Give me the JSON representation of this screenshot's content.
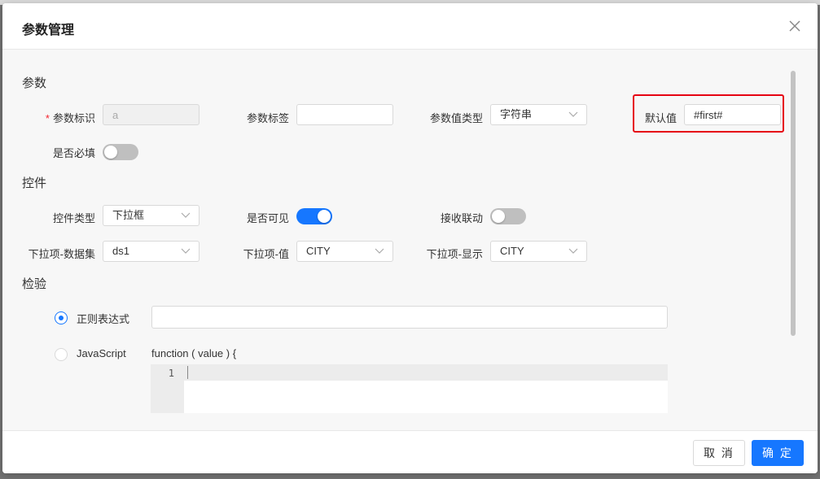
{
  "dialog": {
    "title": "参数管理"
  },
  "sections": {
    "params": "参数",
    "controls": "控件",
    "validation": "检验"
  },
  "params": {
    "id_label": "参数标识",
    "required_mark": "*",
    "id_value": "a",
    "tag_label": "参数标签",
    "tag_value": "",
    "value_type_label": "参数值类型",
    "value_type_selected": "字符串",
    "default_label": "默认值",
    "default_value": "#first#",
    "required_label": "是否必填",
    "required_on": false
  },
  "controls": {
    "type_label": "控件类型",
    "type_selected": "下拉框",
    "visible_label": "是否可见",
    "visible_on": true,
    "linkage_label": "接收联动",
    "linkage_on": false,
    "dataset_label": "下拉项-数据集",
    "dataset_selected": "ds1",
    "value_label": "下拉项-值",
    "value_selected": "CITY",
    "display_label": "下拉项-显示",
    "display_selected": "CITY"
  },
  "validation": {
    "regex_label": "正则表达式",
    "regex_value": "",
    "js_label": "JavaScript",
    "js_signature": "function ( value ) {",
    "line_number": "1",
    "selected": "regex"
  },
  "footer": {
    "cancel_label": "取 消",
    "ok_label": "确 定"
  },
  "colors": {
    "primary": "#1677ff",
    "highlight": "#e60012",
    "required": "#f5222d"
  },
  "icons": [
    "close-icon",
    "chevron-down-icon"
  ]
}
